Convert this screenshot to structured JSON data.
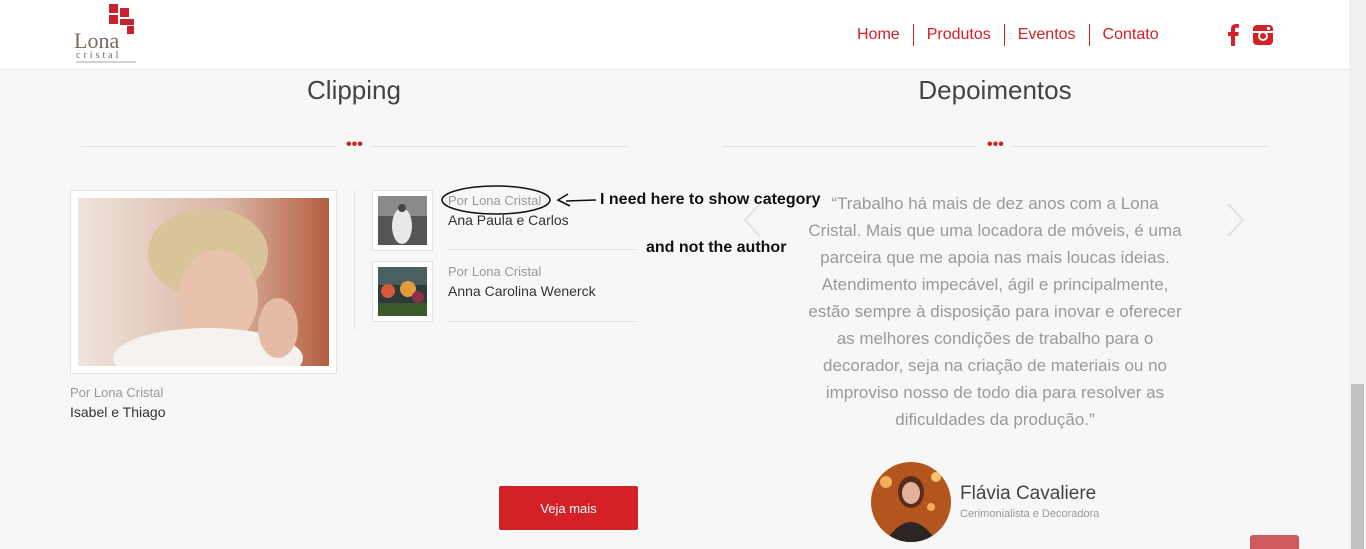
{
  "header": {
    "logo_text": "Lona cristal",
    "nav": [
      "Home",
      "Produtos",
      "Eventos",
      "Contato"
    ],
    "social_icons": [
      "facebook-icon",
      "instagram-icon"
    ]
  },
  "clipping": {
    "title": "Clipping",
    "main": {
      "meta": "Por Lona Cristal",
      "title": "Isabel e Thiago"
    },
    "items": [
      {
        "meta": "Por Lona Cristal",
        "title": "Ana Paula e Carlos"
      },
      {
        "meta": "Por Lona Cristal",
        "title": "Anna Carolina Wenerck"
      }
    ],
    "button": "Veja mais"
  },
  "annotation": {
    "line1": "I need here to show category",
    "line2": "and not the author"
  },
  "depoimentos": {
    "title": "Depoimentos",
    "quote": "“Trabalho há mais de dez anos com a Lona Cristal. Mais que uma locadora de móveis, é uma parceira que me apoia nas mais loucas ideias. Atendimento impecável, ágil e principalmente, estão sempre à disposição para inovar e oferecer as melhores condições de trabalho para o decorador, seja na criação de materiais ou no improviso nosso de todo dia para resolver as dificuldades da produção.”",
    "name": "Flávia Cavaliere",
    "role": "Cerimonialista e Decoradora"
  },
  "colors": {
    "accent": "#d42027"
  }
}
